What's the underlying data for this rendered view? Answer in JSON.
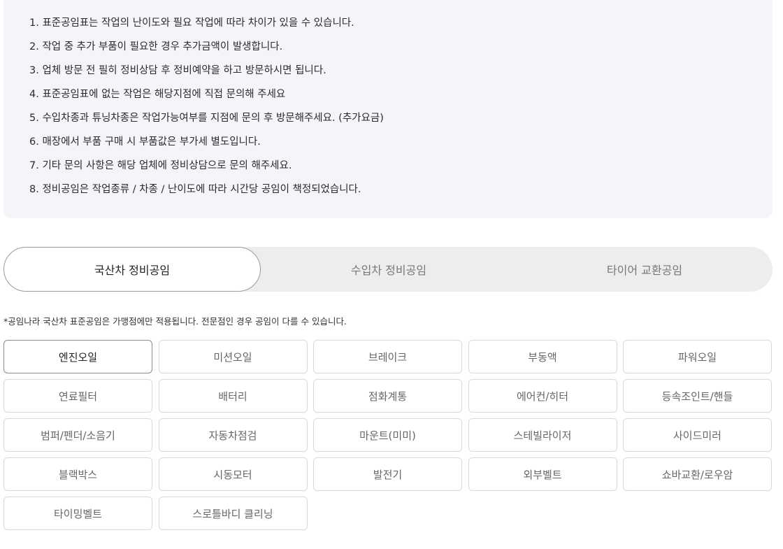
{
  "notices": [
    "1. 표준공임표는 작업의 난이도와 필요 작업에 따라 차이가 있을 수 있습니다.",
    "2. 작업 중 추가 부품이 필요한 경우 추가금액이 발생합니다.",
    "3. 업체 방문 전 필히 정비상담 후 정비예약을 하고 방문하시면 됩니다.",
    "4. 표준공임표에 없는 작업은 해당지점에 직접 문의해 주세요",
    "5. 수입차종과 튜닝차종은 작업가능여부를 지점에 문의 후 방문해주세요. (추가요금)",
    "6. 매장에서 부품 구매 시 부품값은 부가세 별도입니다.",
    "7. 기타 문의 사항은 해당 업체에 정비상담으로 문의 해주세요.",
    "8. 정비공임은 작업종류 / 차종 / 난이도에 따라 시간당 공임이 책정되었습니다."
  ],
  "tabs": [
    {
      "label": "국산차 정비공임",
      "active": true
    },
    {
      "label": "수입차 정비공임",
      "active": false
    },
    {
      "label": "타이어 교환공임",
      "active": false
    }
  ],
  "footnote": "*공임나라 국산차 표준공임은 가맹점에만 적용됩니다. 전문점인 경우 공임이 다를 수 있습니다.",
  "categories": [
    {
      "label": "엔진오일",
      "active": true
    },
    {
      "label": "미션오일",
      "active": false
    },
    {
      "label": "브레이크",
      "active": false
    },
    {
      "label": "부동액",
      "active": false
    },
    {
      "label": "파워오일",
      "active": false
    },
    {
      "label": "연료필터",
      "active": false
    },
    {
      "label": "배터리",
      "active": false
    },
    {
      "label": "점화계통",
      "active": false
    },
    {
      "label": "에어컨/히터",
      "active": false
    },
    {
      "label": "등속조인트/핸들",
      "active": false
    },
    {
      "label": "범퍼/펜더/소음기",
      "active": false
    },
    {
      "label": "자동차점검",
      "active": false
    },
    {
      "label": "마운트(미미)",
      "active": false
    },
    {
      "label": "스테빌라이저",
      "active": false
    },
    {
      "label": "사이드미러",
      "active": false
    },
    {
      "label": "블랙박스",
      "active": false
    },
    {
      "label": "시동모터",
      "active": false
    },
    {
      "label": "발전기",
      "active": false
    },
    {
      "label": "외부벨트",
      "active": false
    },
    {
      "label": "쇼바교환/로우암",
      "active": false
    },
    {
      "label": "타이밍벨트",
      "active": false
    },
    {
      "label": "스로틀바디 클리닝",
      "active": false
    }
  ]
}
